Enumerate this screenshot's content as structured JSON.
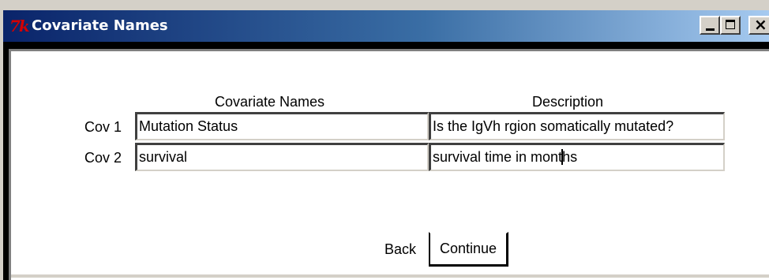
{
  "window": {
    "title": "Covariate Names",
    "logo_text": "7k",
    "controls": {
      "minimize": "minimize",
      "maximize": "maximize",
      "close": "close"
    }
  },
  "headers": {
    "names": "Covariate Names",
    "description": "Description"
  },
  "rows": [
    {
      "label": "Cov 1",
      "name": "Mutation Status",
      "description": "Is the IgVh rgion somatically mutated?"
    },
    {
      "label": "Cov 2",
      "name": "survival",
      "description_before_caret": "survival time in mont",
      "description_after_caret": "hs"
    }
  ],
  "buttons": {
    "back": "Back",
    "continue": "Continue"
  }
}
